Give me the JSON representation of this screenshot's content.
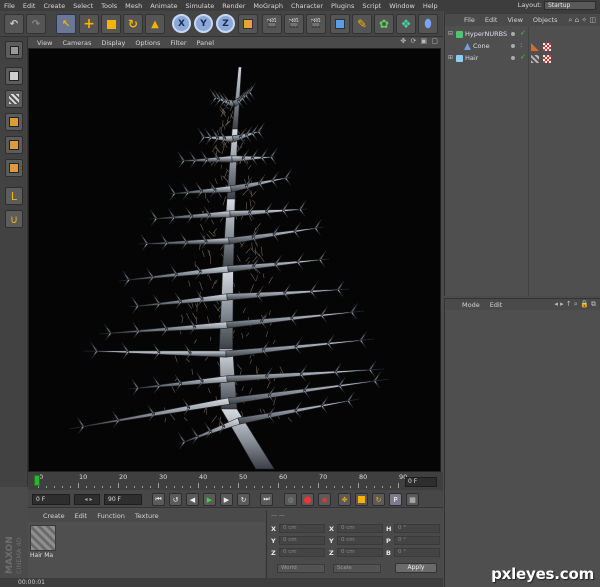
{
  "menubar": {
    "items": [
      "File",
      "Edit",
      "Create",
      "Select",
      "Tools",
      "Mesh",
      "Animate",
      "Simulate",
      "Render",
      "MoGraph",
      "Character",
      "Plugins",
      "Script",
      "Window",
      "Help"
    ],
    "layout_label": "Layout:",
    "layout_value": "Startup"
  },
  "toolbar": {
    "axis_x": "X",
    "axis_y": "Y",
    "axis_z": "Z"
  },
  "viewport": {
    "menu": [
      "View",
      "Cameras",
      "Display",
      "Options",
      "Filter",
      "Panel"
    ],
    "nav_icons": "✥ ⟳ ▣ ▢"
  },
  "timeline": {
    "ticks": [
      "0",
      "10",
      "20",
      "30",
      "40",
      "50",
      "60",
      "70",
      "80",
      "90"
    ],
    "current_frame": "0 F"
  },
  "transport": {
    "start_frame": "0 F",
    "end_frame": "90 F"
  },
  "material_manager": {
    "menu": [
      "Create",
      "Edit",
      "Function",
      "Texture"
    ],
    "material_name": "Hair Ma"
  },
  "coordinates": {
    "rows": [
      {
        "l1": "X",
        "v1": "0 cm",
        "l2": "X",
        "v2": "0 cm",
        "l3": "H",
        "v3": "0 °"
      },
      {
        "l1": "Y",
        "v1": "0 cm",
        "l2": "Y",
        "v2": "0 cm",
        "l3": "P",
        "v3": "0 °"
      },
      {
        "l1": "Z",
        "v1": "0 cm",
        "l2": "Z",
        "v2": "0 cm",
        "l3": "B",
        "v3": "0 °"
      }
    ],
    "mode_world": "World",
    "mode_scale": "Scale",
    "apply": "Apply"
  },
  "statusbar": {
    "time": "00:00:01"
  },
  "brand": {
    "line1": "MAXON",
    "line2": "CINEMA 4D"
  },
  "object_manager": {
    "menu": [
      "File",
      "Edit",
      "View",
      "Objects"
    ],
    "objects": [
      {
        "name": "HyperNURBS",
        "indent": 0
      },
      {
        "name": "Cone",
        "indent": 1
      },
      {
        "name": "Hair",
        "indent": 0
      }
    ]
  },
  "attribute_manager": {
    "menu": [
      "Mode",
      "Edit"
    ]
  },
  "watermark": "pxleyes.com"
}
